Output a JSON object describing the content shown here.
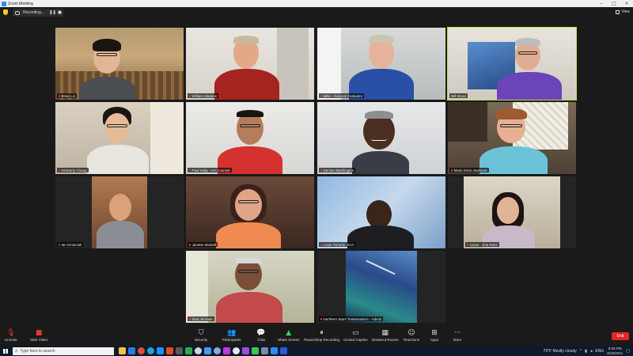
{
  "window": {
    "title": "Zoom Meeting"
  },
  "meeting": {
    "recording_label": "Recording...",
    "view_label": "View"
  },
  "participants": [
    {
      "name": "Brian Lin"
    },
    {
      "name": "William Madson"
    },
    {
      "name": "Mike - General Evaluator"
    },
    {
      "name": "Bill Wood"
    },
    {
      "name": "Kimberly Chung"
    },
    {
      "name": "Paul Holly - AH Counsel"
    },
    {
      "name": "Denise Washington"
    },
    {
      "name": "Marie Kess-Jewhurst"
    },
    {
      "name": "Ian Kmieciak"
    },
    {
      "name": "Janette Markell"
    },
    {
      "name": "Louis Tommie, SAA"
    },
    {
      "name": "Guest - Eva Reitz"
    },
    {
      "name": "Siva Jernade"
    },
    {
      "name": "Northern Stars Toastmasters - Admin"
    }
  ],
  "toolbar": {
    "unmute": "Unmute",
    "start_video": "Start Video",
    "security": "Security",
    "participants": "Participants",
    "participants_count": "14",
    "chat": "Chat",
    "share_screen": "Share Screen",
    "pause_stop_recording": "Pause/Stop Recording",
    "closed_caption": "Closed Caption",
    "breakout_rooms": "Breakout Rooms",
    "reactions": "Reactions",
    "apps": "Apps",
    "more": "More",
    "end": "End"
  },
  "taskbar": {
    "search_placeholder": "Type here to search",
    "weather": "79°F  Mostly cloudy",
    "language": "ENG",
    "time": "8:05 PM",
    "date": "8/18/2021"
  }
}
